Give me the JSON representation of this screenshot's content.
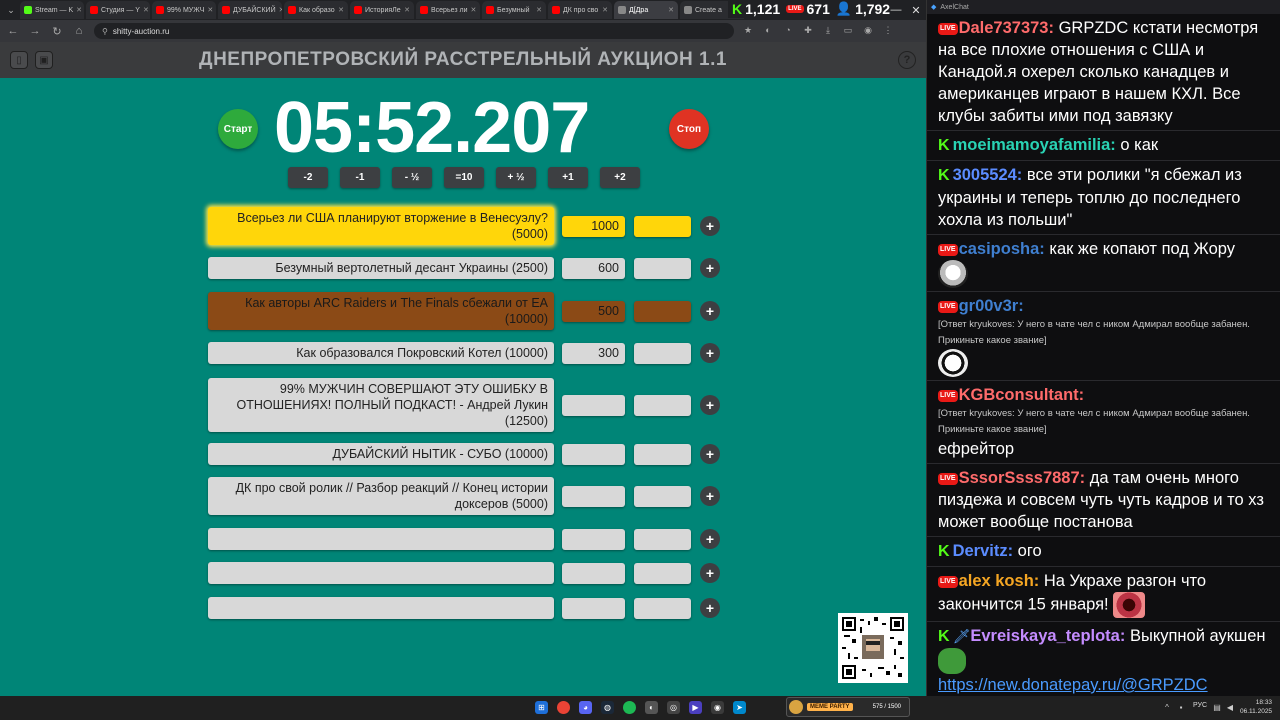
{
  "browser": {
    "tabs": [
      {
        "label": "Stream — K",
        "favicon": "kick"
      },
      {
        "label": "Студия — Y",
        "favicon": "youtube"
      },
      {
        "label": "99% МУЖЧ",
        "favicon": "youtube"
      },
      {
        "label": "ДУБАЙСКИЙ",
        "favicon": "youtube"
      },
      {
        "label": "Как образо",
        "favicon": "youtube"
      },
      {
        "label": "ИсторияЛе",
        "favicon": "youtube"
      },
      {
        "label": "Всерьез ли",
        "favicon": "youtube"
      },
      {
        "label": "Безумный",
        "favicon": "youtube"
      },
      {
        "label": "ДК про сво",
        "favicon": "youtube"
      },
      {
        "label": "Д[Дра",
        "favicon": "web",
        "active": true
      },
      {
        "label": "Create a",
        "favicon": "web"
      }
    ],
    "url": "shitty-auction.ru"
  },
  "viewer_counts": {
    "kick": "1,121",
    "live": "671",
    "total": "1,792"
  },
  "page": {
    "title": "ДНЕПРОПЕТРОВСКИЙ РАССТРЕЛЬНЫЙ АУКЦИОН 1.1",
    "timer": "05:52.207",
    "start_label": "Старт",
    "stop_label": "Стоп",
    "adjust_buttons": [
      "-2",
      "-1",
      "- ½",
      "=10",
      "+ ½",
      "+1",
      "+2"
    ],
    "lots": [
      {
        "name": "Всерьез ли США планируют вторжение в Венесуэлу? (5000)",
        "amount": "1000",
        "style": "gold"
      },
      {
        "name": "Безумный вертолетный десант Украины (2500)",
        "amount": "600",
        "style": "plain"
      },
      {
        "name": "Как авторы ARC Raiders и The Finals сбежали от EA (10000)",
        "amount": "500",
        "style": "brown"
      },
      {
        "name": "Как образовался Покровский Котел (10000)",
        "amount": "300",
        "style": "plain"
      },
      {
        "name": "99% МУЖЧИН СОВЕРШАЮТ ЭТУ ОШИБКУ В ОТНОШЕНИЯХ! ПОЛНЫЙ ПОДКАСТ! - Андрей Лукин (12500)",
        "amount": "",
        "style": "plain"
      },
      {
        "name": "ДУБАЙСКИЙ НЫТИК - СУБО (10000)",
        "amount": "",
        "style": "plain"
      },
      {
        "name": "ДК про свой ролик // Разбор реакций // Конец истории доксеров (5000)",
        "amount": "",
        "style": "plain"
      },
      {
        "name": "",
        "amount": "",
        "style": "plain"
      },
      {
        "name": "",
        "amount": "",
        "style": "plain"
      },
      {
        "name": "",
        "amount": "",
        "style": "plain"
      }
    ],
    "add_label": "+"
  },
  "chat": {
    "window_title": "AxelChat",
    "messages": [
      {
        "platform": "live",
        "user": "Dale737373:",
        "user_color": "#ff6b6b",
        "text": "GRPZDC кстати несмотря на все плохие отношения с США и Канадой.я охерел сколько канадцев и американцев играют в нашем КХЛ. Все клубы забиты ими под завязку"
      },
      {
        "platform": "kick",
        "user": "moeimamoyafamilia:",
        "user_color": "#29d3b4",
        "text": "о как"
      },
      {
        "platform": "kick",
        "user": "3005524:",
        "user_color": "#5b8cff",
        "text": "все эти ролики \"я сбежал из украины и теперь топлю до последнего хохла из польши\""
      },
      {
        "platform": "live",
        "user": "casiposha:",
        "user_color": "#3f7fd0",
        "text": "как же копают под Жору"
      },
      {
        "platform": "live",
        "user": "gr00v3r:",
        "user_color": "#3f7fd0",
        "reply": "[Ответ kryukoves: У него в чате чел с ником Адмирал вообще забанен. Прикиньте какое звание]",
        "text": ""
      },
      {
        "platform": "live",
        "user": "KGBconsultant:",
        "user_color": "#ff6b6b",
        "reply": "[Ответ kryukoves: У него в чате чел с ником Адмирал вообще забанен. Прикиньте какое звание]",
        "text": "ефрейтор"
      },
      {
        "platform": "live",
        "user": "SssorSsss7887:",
        "user_color": "#ff6b6b",
        "text": "да там очень много пиздежа и совсем чуть чуть кадров и то хз может вообще постанова"
      },
      {
        "platform": "kick",
        "user": "Dervitz:",
        "user_color": "#5b8cff",
        "text": "ого"
      },
      {
        "platform": "live",
        "user": "alex kosh:",
        "user_color": "#f5a623",
        "text": "На Украхе разгон что закончится 15 января!"
      },
      {
        "platform": "kick",
        "user": "Evreiskaya_teplota:",
        "user_color": "#c48cff",
        "text": "Выкупной аукшен",
        "link": "https://new.donatepay.ru/@GRPZDC"
      }
    ]
  },
  "taskbar": {
    "banner_text": "MEME PARTY",
    "banner_counter": "575 / 1500",
    "lang": "РУС",
    "time": "18:33",
    "date": "06.11.2025"
  },
  "colors": {
    "page_bg": "#008577",
    "gold": "#ffd60a",
    "brown": "#8b4a16",
    "start": "#2eaa3c",
    "stop": "#df3323"
  }
}
